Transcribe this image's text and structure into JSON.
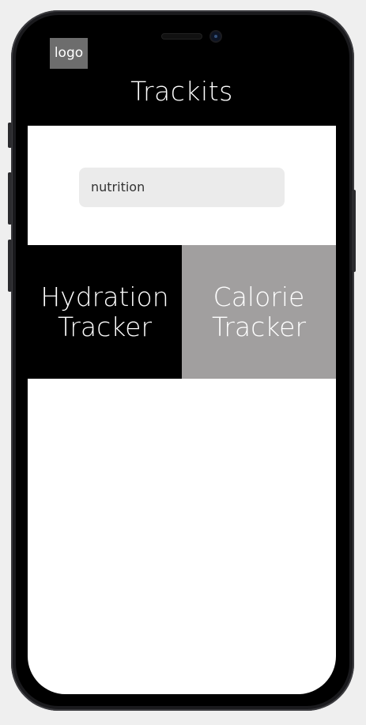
{
  "app": {
    "logo_label": "logo",
    "title": "Trackits"
  },
  "search": {
    "value": "nutrition"
  },
  "tiles": [
    {
      "label": "Hydration\nTracker",
      "color": "#000000"
    },
    {
      "label": "Calorie\nTracker",
      "color": "#a19f9f"
    }
  ]
}
